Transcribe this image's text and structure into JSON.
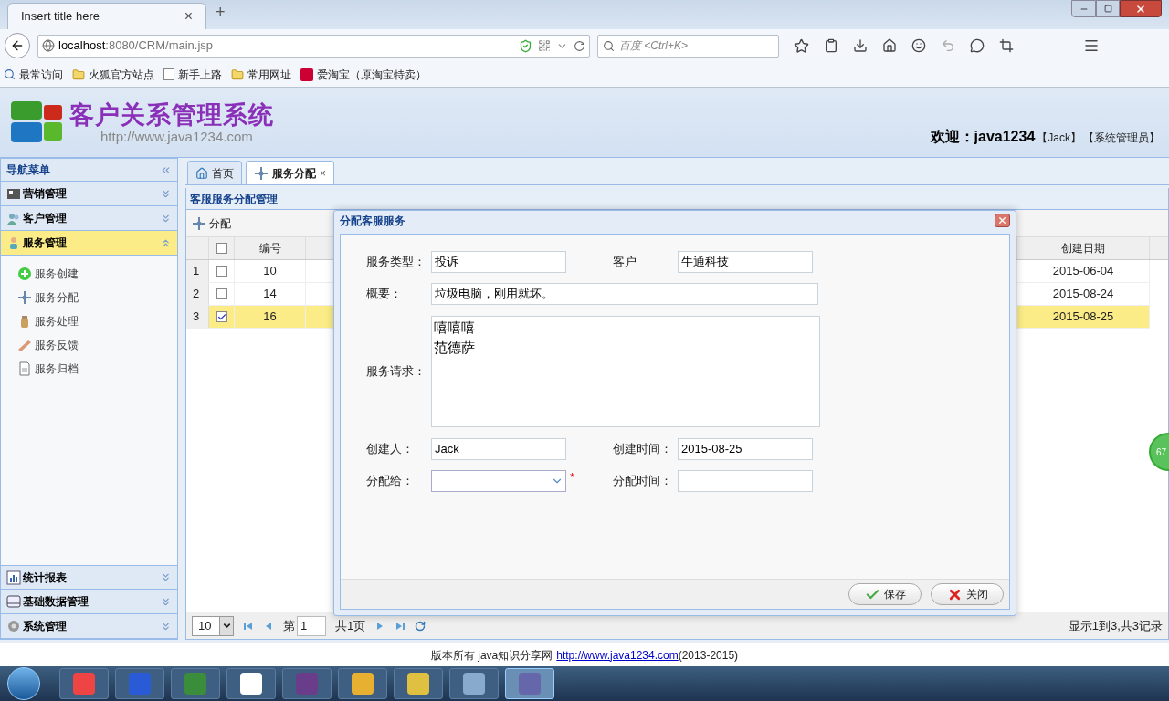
{
  "browser": {
    "tab_title": "Insert title here",
    "tab_close": "×",
    "new_tab": "+",
    "url_host": "localhost",
    "url_rest": ":8080/CRM/main.jsp",
    "search_placeholder": "百度 <Ctrl+K>",
    "bookmarks": [
      "最常访问",
      "火狐官方站点",
      "新手上路",
      "常用网址",
      "爱淘宝（原淘宝特卖）"
    ]
  },
  "app_header": {
    "title": "客户关系管理系统",
    "url": "http://www.java1234.com",
    "welcome": "欢迎：java1234",
    "user": "【Jack】",
    "role": "【系统管理员】"
  },
  "sidebar": {
    "title": "导航菜单",
    "sections": [
      {
        "label": "营销管理",
        "expanded": false
      },
      {
        "label": "客户管理",
        "expanded": false
      },
      {
        "label": "服务管理",
        "expanded": true,
        "children": [
          {
            "label": "服务创建"
          },
          {
            "label": "服务分配"
          },
          {
            "label": "服务处理"
          },
          {
            "label": "服务反馈"
          },
          {
            "label": "服务归档"
          }
        ]
      },
      {
        "label": "统计报表",
        "expanded": false
      },
      {
        "label": "基础数据管理",
        "expanded": false
      },
      {
        "label": "系统管理",
        "expanded": false
      }
    ]
  },
  "tabs": [
    {
      "label": "首页",
      "selected": false
    },
    {
      "label": "服务分配",
      "selected": true,
      "close": "×"
    }
  ],
  "panel": {
    "title": "客服服务分配管理",
    "toolbar_button": "分配",
    "columns": {
      "number": "编号",
      "created": "创建日期",
      "select_all_checked": false
    },
    "rows": [
      {
        "index": "1",
        "number": "10",
        "created": "2015-06-04",
        "checked": false,
        "selected": false
      },
      {
        "index": "2",
        "number": "14",
        "created": "2015-08-24",
        "checked": false,
        "selected": false
      },
      {
        "index": "3",
        "number": "16",
        "created": "2015-08-25",
        "checked": true,
        "selected": true
      }
    ],
    "pager": {
      "page_size": "10",
      "page_label": "第",
      "page": "1",
      "total_pages": "共1页",
      "summary": "显示1到3,共3记录"
    }
  },
  "dialog": {
    "title": "分配客服服务",
    "fields": [
      {
        "label": "服务类型：",
        "value": "投诉",
        "kind": "text"
      },
      {
        "label": "客户",
        "value": "牛通科技",
        "kind": "text"
      },
      {
        "label": "概要：",
        "value": "垃圾电脑，刚用就坏。",
        "kind": "wide"
      },
      {
        "label": "服务请求：",
        "lines": [
          "嘻嘻嘻",
          "范德萨"
        ],
        "kind": "textarea"
      },
      {
        "label": "创建人：",
        "value": "Jack",
        "kind": "text"
      },
      {
        "label": "创建时间：",
        "value": "2015-08-25",
        "kind": "text"
      },
      {
        "label": "分配给：",
        "kind": "select",
        "required": "*"
      },
      {
        "label": "分配时间：",
        "kind": "text"
      }
    ],
    "buttons": [
      {
        "label": "保存",
        "kind": "save"
      },
      {
        "label": "关闭",
        "kind": "close"
      }
    ]
  },
  "footer": {
    "text": "版本所有 java知识分享网",
    "link": "http://www.java1234.com",
    "years": "(2013-2015)"
  },
  "floating_badge": "67"
}
